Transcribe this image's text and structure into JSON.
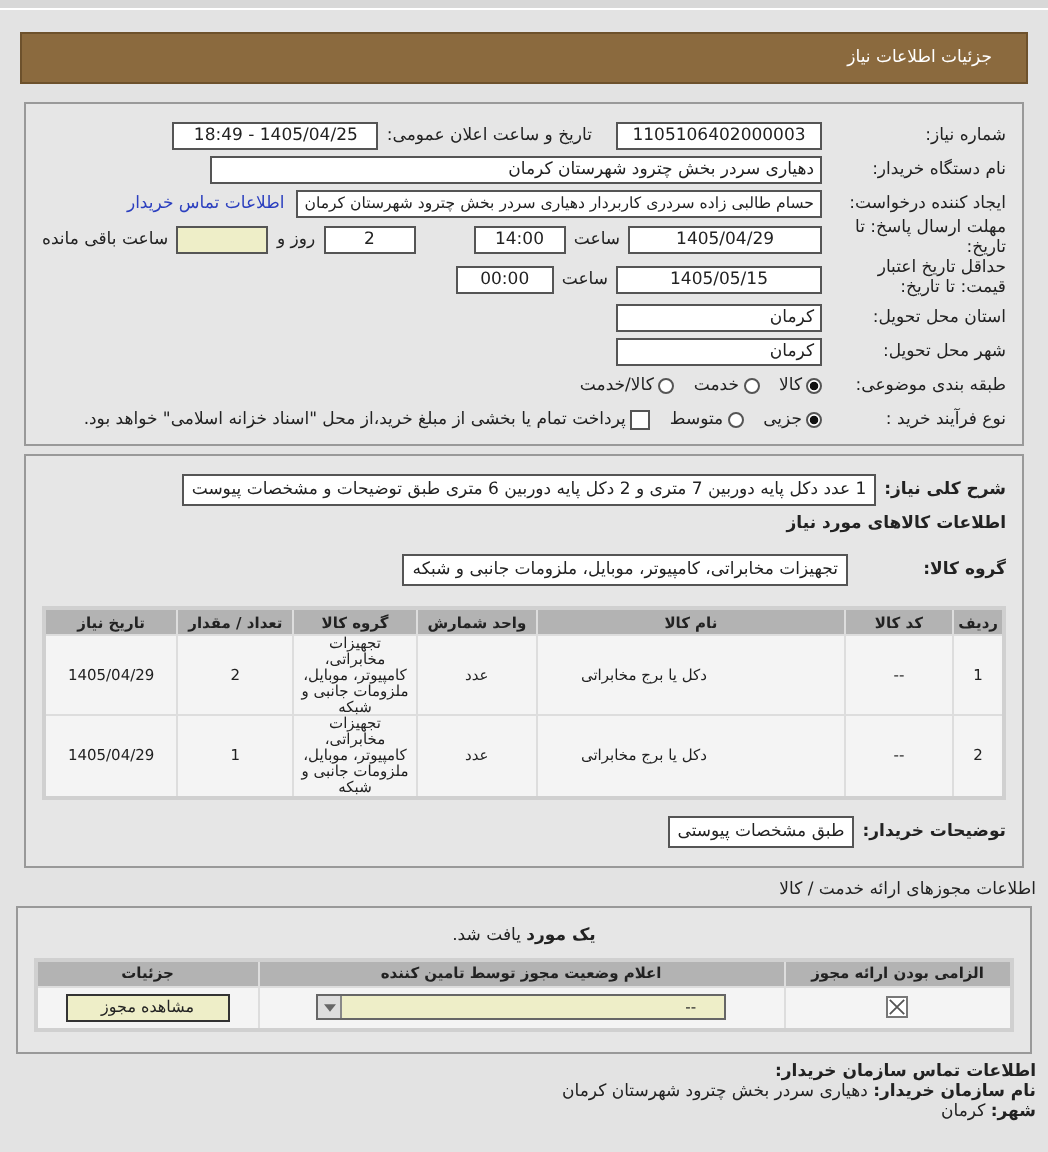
{
  "header": {
    "title": "جزئیات اطلاعات نیاز"
  },
  "need": {
    "number_label": "شماره نیاز:",
    "number": "1105106402000003",
    "announce_label": "تاریخ و ساعت اعلان عمومی:",
    "announce": "1405/04/25 - 18:49",
    "buyer_label": "نام دستگاه خریدار:",
    "buyer": "دهیاری سردر بخش چترود شهرستان کرمان",
    "creator_label": "ایجاد کننده درخواست:",
    "creator": "حسام طالبی زاده سردری کاربردار دهیاری سردر بخش چترود شهرستان کرمان",
    "contact_link": "اطلاعات تماس خریدار",
    "deadline_label": "مهلت ارسال پاسخ: تا تاریخ:",
    "deadline_date": "1405/04/29",
    "hour_label": "ساعت",
    "deadline_time": "14:00",
    "days": "2",
    "days_label": "روز و",
    "remaining_label": "ساعت باقی مانده",
    "validity_label": "حداقل تاریخ اعتبار قیمت: تا تاریخ:",
    "validity_date": "1405/05/15",
    "validity_hour_label": "ساعت",
    "validity_time": "00:00",
    "province_label": "استان محل تحویل:",
    "province": "کرمان",
    "city_label": "شهر محل تحویل:",
    "city": "کرمان",
    "category_label": "طبقه بندی موضوعی:",
    "categories": [
      {
        "label": "کالا",
        "selected": true
      },
      {
        "label": "خدمت",
        "selected": false
      },
      {
        "label": "کالا/خدمت",
        "selected": false
      }
    ],
    "process_label": "نوع فرآیند خرید :",
    "processes": [
      {
        "label": "جزیی",
        "selected": true
      },
      {
        "label": "متوسط",
        "selected": false
      }
    ],
    "treasury": {
      "label": "پرداخت تمام یا بخشی از مبلغ خرید،از محل \"اسناد خزانه اسلامی\" خواهد بود.",
      "checked": false
    }
  },
  "goods": {
    "summary_label": "شرح کلی نیاز:",
    "summary": "1 عدد دکل پایه دوربین 7 متری و 2 دکل پایه دوربین 6 متری طبق توضیحات و مشخصات پیوست",
    "title": "اطلاعات کالاهای مورد نیاز",
    "group_label": "گروه کالا:",
    "group": "تجهیزات مخابراتی، کامپیوتر، موبایل، ملزومات جانبی و شبکه",
    "columns": [
      "ردیف",
      "کد کالا",
      "نام کالا",
      "واحد شمارش",
      "گروه کالا",
      "تعداد / مقدار",
      "تاریخ نیاز"
    ],
    "rows": [
      [
        "1",
        "--",
        "دکل یا برج مخابراتی",
        "عدد",
        "تجهیزات مخابراتی، کامپیوتر، موبایل، ملزومات جانبی و شبکه",
        "2",
        "1405/04/29"
      ],
      [
        "2",
        "--",
        "دکل یا برج مخابراتی",
        "عدد",
        "تجهیزات مخابراتی، کامپیوتر، موبایل، ملزومات جانبی و شبکه",
        "1",
        "1405/04/29"
      ]
    ],
    "notes_label": "توضیحات خریدار:",
    "notes": "طبق مشخصات پیوستی"
  },
  "licenses": {
    "title": "اطلاعات مجوزهای ارائه خدمت / کالا",
    "found": "**یک مورد** یافت شد.",
    "columns": [
      "الزامی بودن ارائه مجوز",
      "اعلام وضعیت مجوز توسط تامین کننده",
      "جزئیات"
    ],
    "row": {
      "required": true,
      "status": "--",
      "button": "مشاهده مجوز"
    }
  },
  "contact": {
    "title": "اطلاعات تماس سازمان خریدار:",
    "org_label": "نام سازمان خریدار:",
    "org": "دهیاری سردر بخش چترود شهرستان کرمان",
    "city_label": "شهر:",
    "city": "کرمان"
  }
}
